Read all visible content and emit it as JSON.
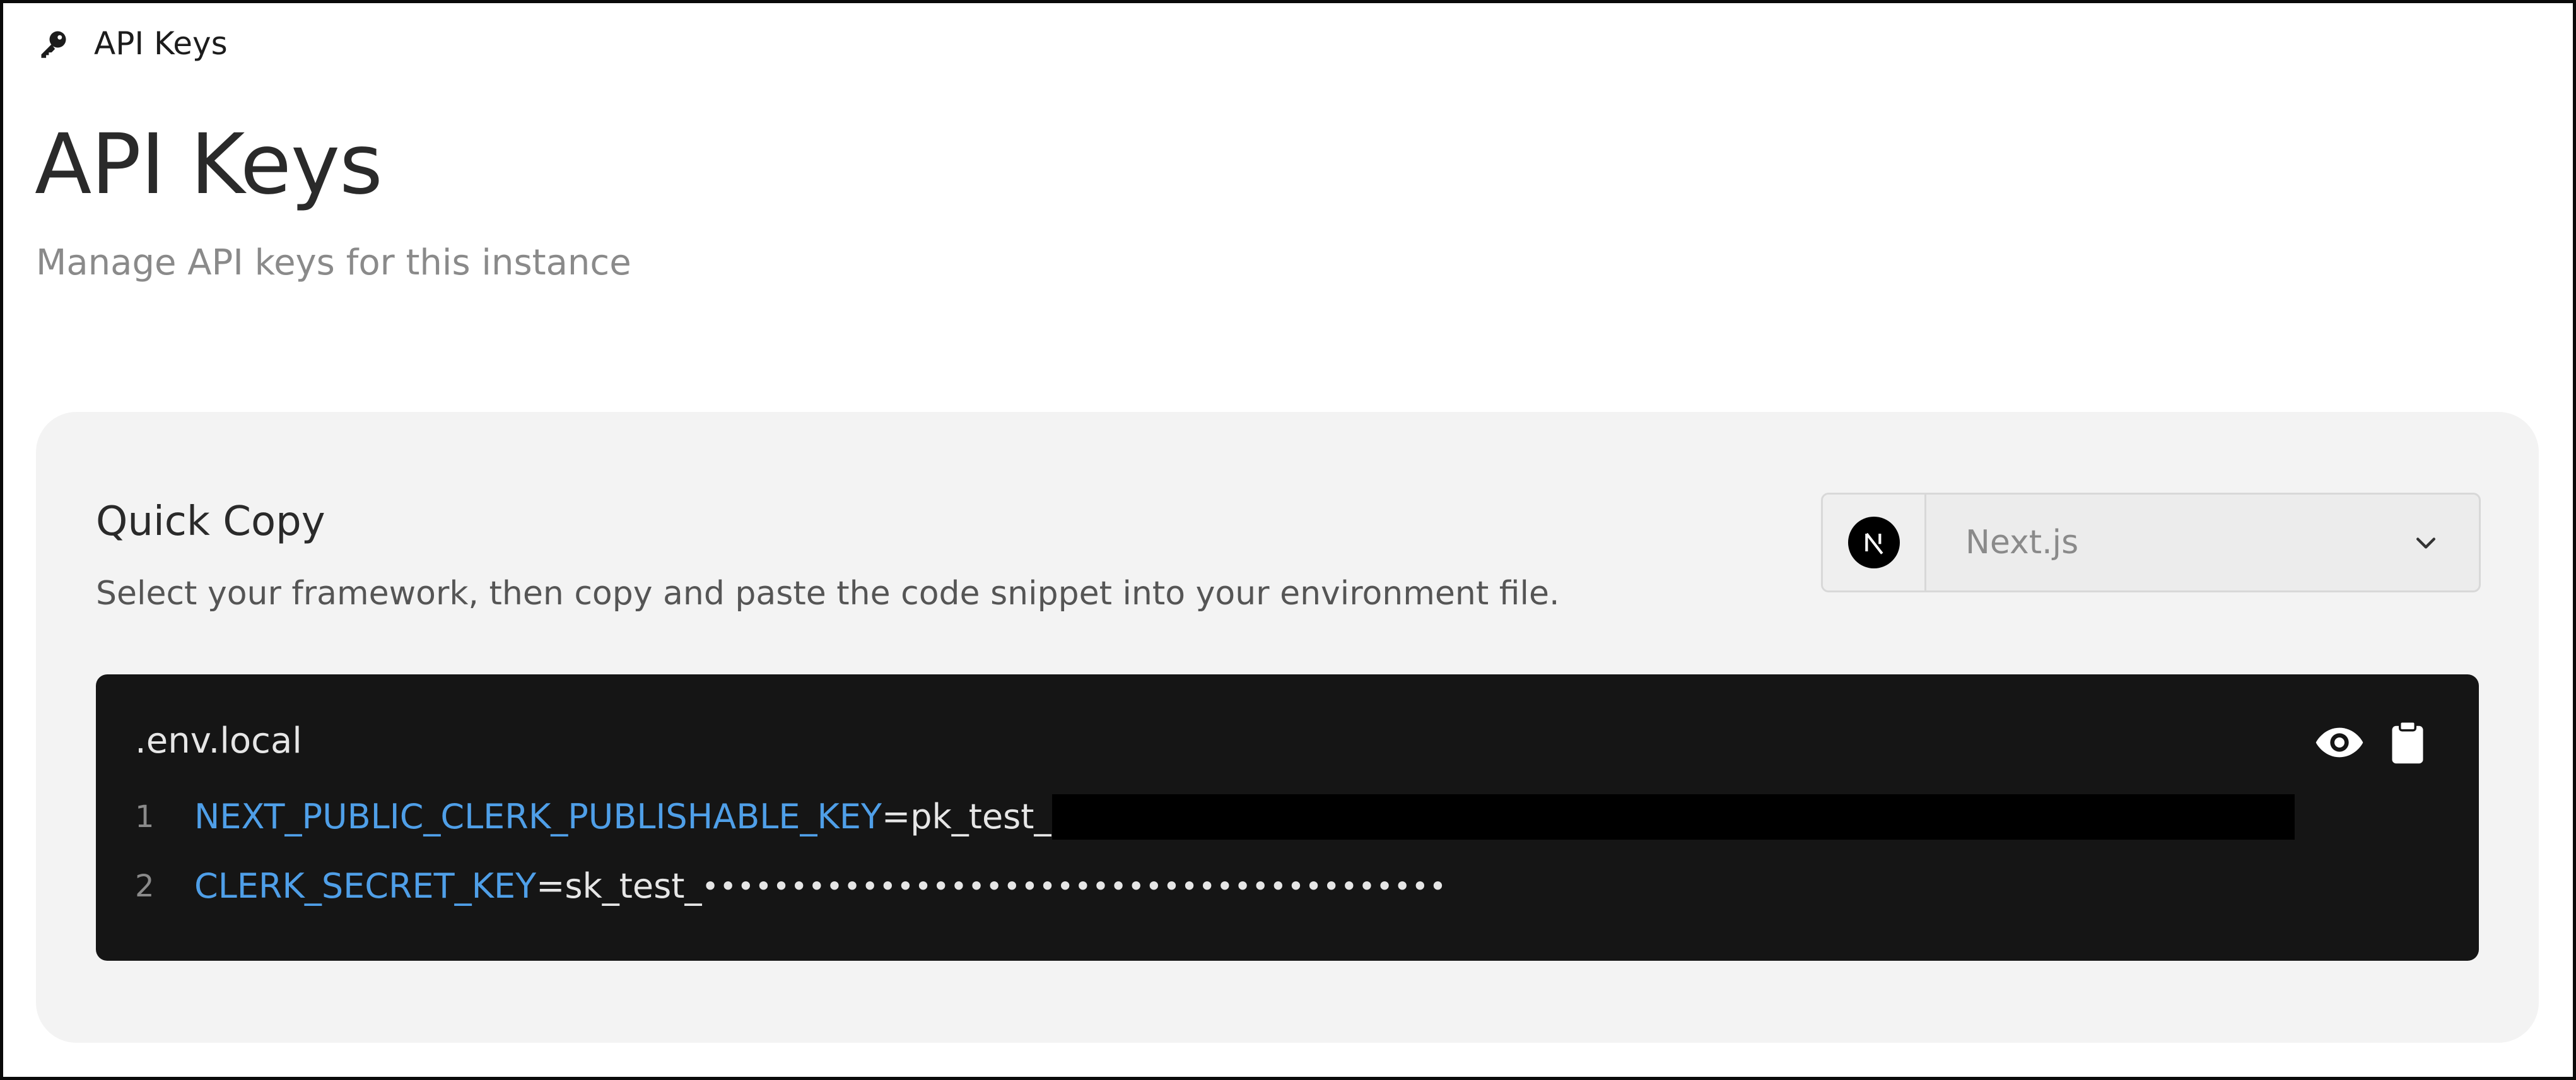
{
  "breadcrumb": {
    "icon": "key-icon",
    "label": "API Keys"
  },
  "header": {
    "title": "API Keys",
    "subtitle": "Manage API keys for this instance"
  },
  "quick_copy": {
    "title": "Quick Copy",
    "description": "Select your framework, then copy and paste the code snippet into your environment file.",
    "framework_select": {
      "logo_icon": "nextjs-logo-icon",
      "selected": "Next.js",
      "chevron_icon": "chevron-down-icon"
    },
    "code_block": {
      "file_name": ".env.local",
      "actions": [
        {
          "name": "toggle-visibility",
          "icon": "eye-icon"
        },
        {
          "name": "copy",
          "icon": "clipboard-icon"
        }
      ],
      "lines": [
        {
          "number": "1",
          "key": "NEXT_PUBLIC_CLERK_PUBLISHABLE_KEY",
          "equals": "=",
          "value_prefix": "pk_test_",
          "redacted": true
        },
        {
          "number": "2",
          "key": "CLERK_SECRET_KEY",
          "equals": "=",
          "value_prefix": "sk_test_",
          "masked": "••••••••••••••••••••••••••••••••••••••••••"
        }
      ]
    }
  },
  "colors": {
    "key_blue": "#4f9fe8",
    "code_bg": "#151515",
    "card_bg": "#f3f3f3"
  }
}
